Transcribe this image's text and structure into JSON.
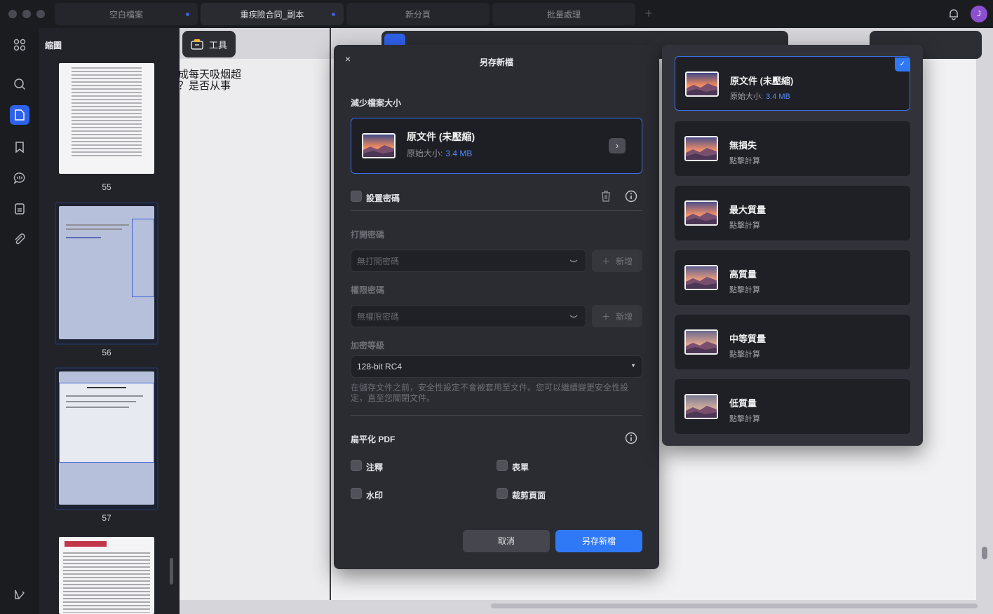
{
  "tabs": [
    {
      "label": "空白檔案",
      "modified": true
    },
    {
      "label": "重疾險合同_副本",
      "modified": true,
      "active": true
    },
    {
      "label": "新分頁",
      "modified": false
    },
    {
      "label": "批量處理",
      "modified": false
    }
  ],
  "user": {
    "avatar_initial": "J"
  },
  "thumbnails": {
    "title": "縮圖",
    "pages": [
      "55",
      "56",
      "57"
    ]
  },
  "tools": {
    "label": "工具"
  },
  "document": {
    "visible_text": "成每天吸烟超\n？是否从事"
  },
  "dialog": {
    "close": "×",
    "title": "另存新檔",
    "reduce_size_label": "減少檔案大小",
    "compression": {
      "title": "原文件 (未壓縮)",
      "sub_label": "原始大小:",
      "size": "3.4 MB",
      "arrow": "›"
    },
    "password": {
      "set_label": "設置密碼",
      "open_label": "打開密碼",
      "open_placeholder": "無打開密碼",
      "permission_label": "權限密碼",
      "permission_placeholder": "無權限密碼",
      "add_label": "新增",
      "encryption_label": "加密等級",
      "encryption_value": "128-bit RC4",
      "note": "在儲存文件之前，安全性設定不會被套用至文件。您可以繼續變更安全性設定，直至您關閉文件。"
    },
    "flatten": {
      "label": "扁平化 PDF",
      "options": [
        "注釋",
        "表單",
        "水印",
        "裁剪頁面"
      ]
    },
    "cancel": "取消",
    "save": "另存新檔"
  },
  "dropdown": {
    "options": [
      {
        "title": "原文件 (未壓縮)",
        "sub": "原始大小:",
        "size": "3.4 MB",
        "selected": true
      },
      {
        "title": "無損失",
        "sub": "點擊計算",
        "selected": false
      },
      {
        "title": "最大質量",
        "sub": "點擊計算",
        "selected": false
      },
      {
        "title": "高質量",
        "sub": "點擊計算",
        "selected": false
      },
      {
        "title": "中等質量",
        "sub": "點擊計算",
        "selected": false
      },
      {
        "title": "低質量",
        "sub": "點擊計算",
        "selected": false
      }
    ],
    "check": "✓"
  },
  "colors": {
    "accent": "#2f78f6",
    "selected_border": "#3b6ff0",
    "dialog_bg": "#2b2c32"
  }
}
